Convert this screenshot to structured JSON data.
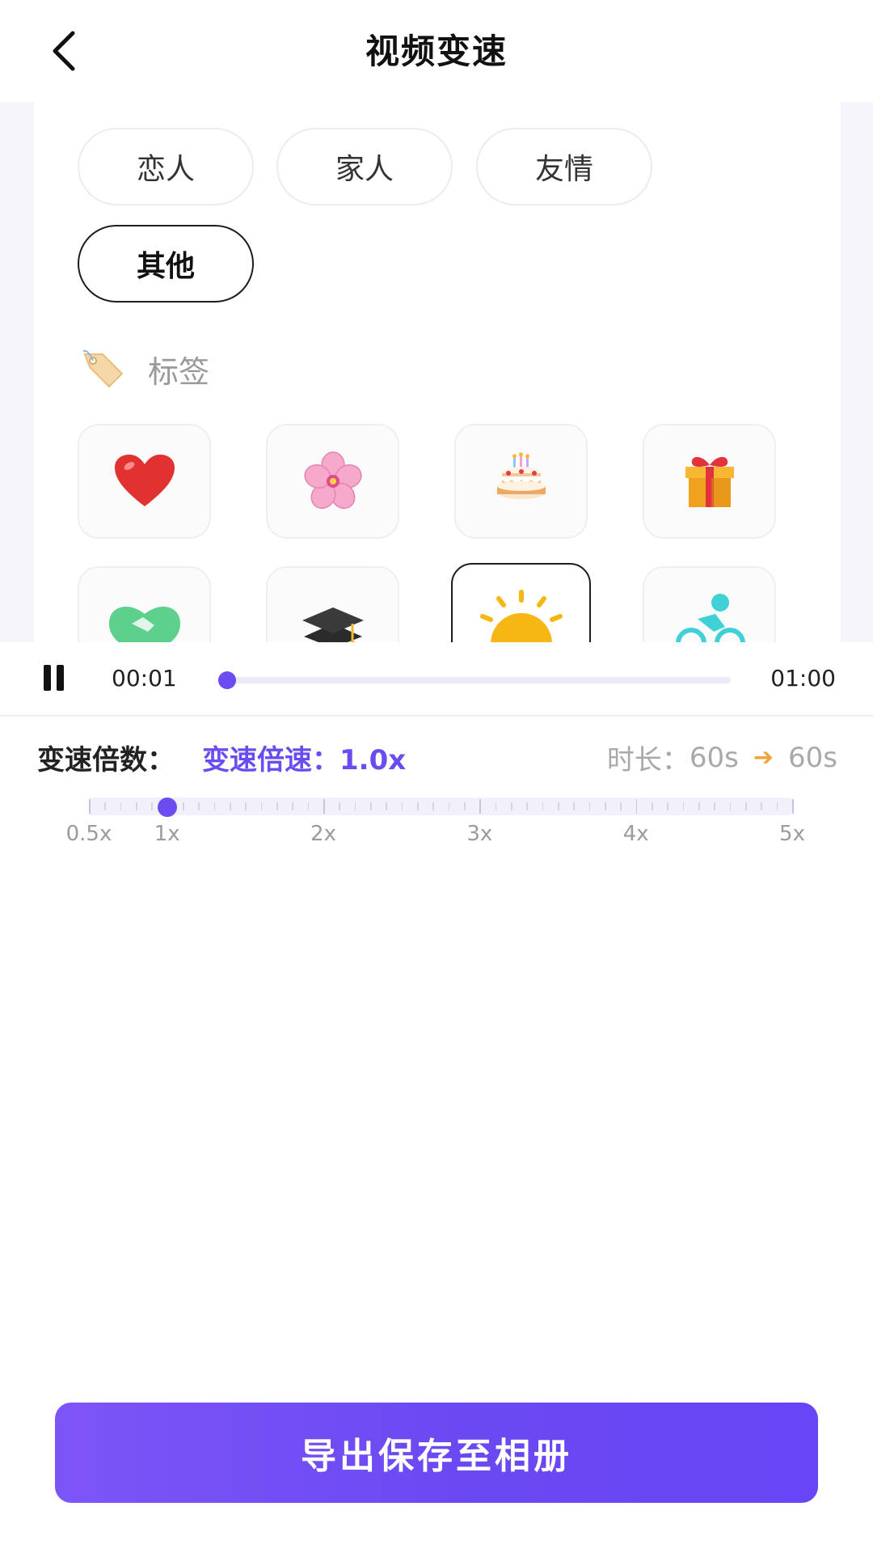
{
  "header": {
    "title": "视频变速",
    "back_icon": "chevron-left-icon"
  },
  "preview": {
    "chips": [
      {
        "label": "恋人",
        "selected": false
      },
      {
        "label": "家人",
        "selected": false
      },
      {
        "label": "友情",
        "selected": false
      },
      {
        "label": "其他",
        "selected": true
      }
    ],
    "tag_section": {
      "icon": "tag-icon",
      "label": "标签"
    },
    "emoji_tiles": [
      {
        "icon": "heart-icon",
        "selected": false
      },
      {
        "icon": "cherry-blossom-icon",
        "selected": false
      },
      {
        "icon": "birthday-cake-icon",
        "selected": false
      },
      {
        "icon": "gift-icon",
        "selected": false
      },
      {
        "icon": "handshake-icon",
        "selected": false
      },
      {
        "icon": "graduation-cap-icon",
        "selected": false
      },
      {
        "icon": "sun-icon",
        "selected": true
      },
      {
        "icon": "cyclist-icon",
        "selected": false
      }
    ]
  },
  "player": {
    "state_icon": "pause-icon",
    "current_time": "00:01",
    "total_time": "01:00",
    "progress": 0.017
  },
  "speed": {
    "label": "变速倍数：",
    "value_text": "变速倍速：1.0x",
    "duration_label": "时长：",
    "duration_from": "60s",
    "arrow_icon": "arrow-right-icon",
    "duration_to": "60s",
    "current": 1.0,
    "min": 0.5,
    "max": 5,
    "tick_labels": [
      "0.5x",
      "1x",
      "2x",
      "3x",
      "4x",
      "5x"
    ],
    "tick_values": [
      0.5,
      1,
      2,
      3,
      4,
      5
    ]
  },
  "export_button": {
    "label": "导出保存至相册"
  },
  "colors": {
    "accent": "#6a4cf0",
    "duration_arrow": "#f2a43a",
    "muted_text": "#a9a9a9"
  }
}
